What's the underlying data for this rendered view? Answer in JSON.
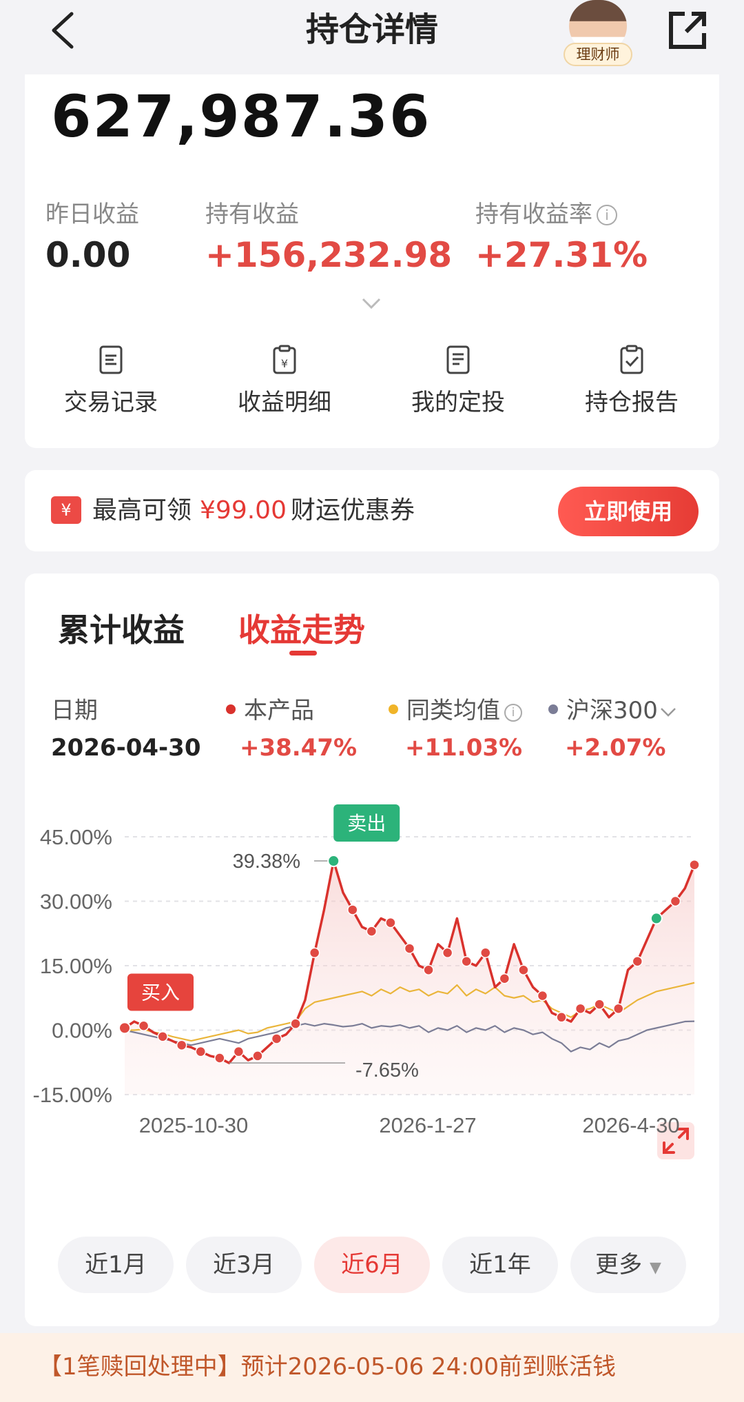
{
  "header": {
    "title": "持仓详情",
    "advisor_label": "理财师"
  },
  "summary": {
    "total_value": "627,987.36",
    "yesterday_label": "昨日收益",
    "yesterday_value": "0.00",
    "holding_label": "持有收益",
    "holding_value": "+156,232.98",
    "rate_label": "持有收益率",
    "rate_value": "+27.31%",
    "actions": [
      "交易记录",
      "收益明细",
      "我的定投",
      "持仓报告"
    ]
  },
  "coupon": {
    "prefix": "最高可领",
    "amount": "¥99.00",
    "suffix": "财运优惠券",
    "button": "立即使用",
    "icon": "¥"
  },
  "chart_card": {
    "tabs": [
      "累计收益",
      "收益走势"
    ],
    "active_tab": "收益走势",
    "date_label": "日期",
    "date_value": "2026-04-30",
    "series_labels": [
      "本产品",
      "同类均值",
      "沪深300"
    ],
    "series_values": [
      "+38.47%",
      "+11.03%",
      "+2.07%"
    ],
    "range_buttons": [
      "近1月",
      "近3月",
      "近6月",
      "近1年",
      "更多"
    ],
    "active_range": "近6月",
    "buy_tag": "买入",
    "sell_tag": "卖出",
    "high_label": "39.38%",
    "low_label": "-7.65%"
  },
  "colors": {
    "accent": "#e53935",
    "category": "#f0b429",
    "index": "#7b7d96",
    "positive": "#e24a44",
    "sell": "#2cb37a"
  },
  "chart_data": {
    "type": "line",
    "x_labels": [
      "2025-10-30",
      "2026-1-27",
      "2026-4-30"
    ],
    "y_ticks": [
      "45.00%",
      "30.00%",
      "15.00%",
      "0.00%",
      "-15.00%"
    ],
    "ylim": [
      -15,
      45
    ],
    "series": [
      {
        "name": "本产品",
        "color": "#d9322d",
        "values": [
          0.5,
          2.0,
          1.0,
          -0.5,
          -1.5,
          -2.5,
          -3.5,
          -4.0,
          -5.0,
          -6.0,
          -6.5,
          -7.65,
          -5.0,
          -7.0,
          -6.0,
          -4.0,
          -2.0,
          -1.0,
          1.5,
          7.0,
          18.0,
          28.0,
          39.38,
          32.0,
          28.0,
          24.0,
          23.0,
          26.0,
          25.0,
          22.0,
          19.0,
          15.0,
          14.0,
          20.0,
          18.0,
          26.0,
          16.0,
          15.0,
          18.0,
          10.0,
          12.0,
          20.0,
          14.0,
          10.0,
          8.0,
          4.0,
          3.0,
          2.0,
          5.0,
          4.0,
          6.0,
          3.0,
          5.0,
          14.0,
          16.0,
          21.0,
          26.0,
          28.0,
          30.0,
          33.0,
          38.47
        ]
      },
      {
        "name": "同类均值",
        "color": "#eab53a",
        "values": [
          0.0,
          0.0,
          0.2,
          -0.5,
          -0.8,
          -1.5,
          -2.0,
          -2.5,
          -2.0,
          -1.5,
          -1.0,
          -0.5,
          0.0,
          -0.8,
          -0.5,
          0.5,
          1.0,
          1.5,
          2.0,
          5.0,
          6.5,
          7.0,
          7.5,
          8.0,
          8.5,
          9.0,
          8.0,
          9.5,
          8.5,
          10.0,
          9.0,
          9.5,
          8.0,
          9.0,
          8.5,
          10.5,
          8.0,
          9.5,
          8.5,
          10.0,
          8.0,
          7.5,
          8.0,
          6.5,
          7.0,
          5.0,
          4.0,
          3.0,
          4.5,
          5.0,
          6.0,
          5.0,
          4.0,
          5.5,
          7.0,
          8.0,
          9.0,
          9.5,
          10.0,
          10.5,
          11.03
        ]
      },
      {
        "name": "沪深300",
        "color": "#7b7d96",
        "values": [
          0.0,
          -0.5,
          -1.0,
          -1.5,
          -2.0,
          -2.5,
          -3.0,
          -3.5,
          -3.0,
          -2.5,
          -2.0,
          -2.5,
          -3.0,
          -2.0,
          -1.5,
          -1.0,
          -0.5,
          0.5,
          1.0,
          1.5,
          1.0,
          1.5,
          1.2,
          0.8,
          1.0,
          1.5,
          0.5,
          1.0,
          0.8,
          1.2,
          0.5,
          1.0,
          -0.5,
          0.5,
          0.0,
          1.0,
          -0.5,
          0.5,
          0.0,
          1.0,
          -0.5,
          0.5,
          0.0,
          -1.0,
          -0.5,
          -2.0,
          -3.0,
          -5.0,
          -4.0,
          -4.5,
          -3.0,
          -4.0,
          -2.5,
          -2.0,
          -1.0,
          0.0,
          0.5,
          1.0,
          1.5,
          2.0,
          2.07
        ]
      }
    ]
  },
  "bottom_banner": {
    "text": "【1笔赎回处理中】预计2026-05-06 24:00前到账活钱"
  }
}
